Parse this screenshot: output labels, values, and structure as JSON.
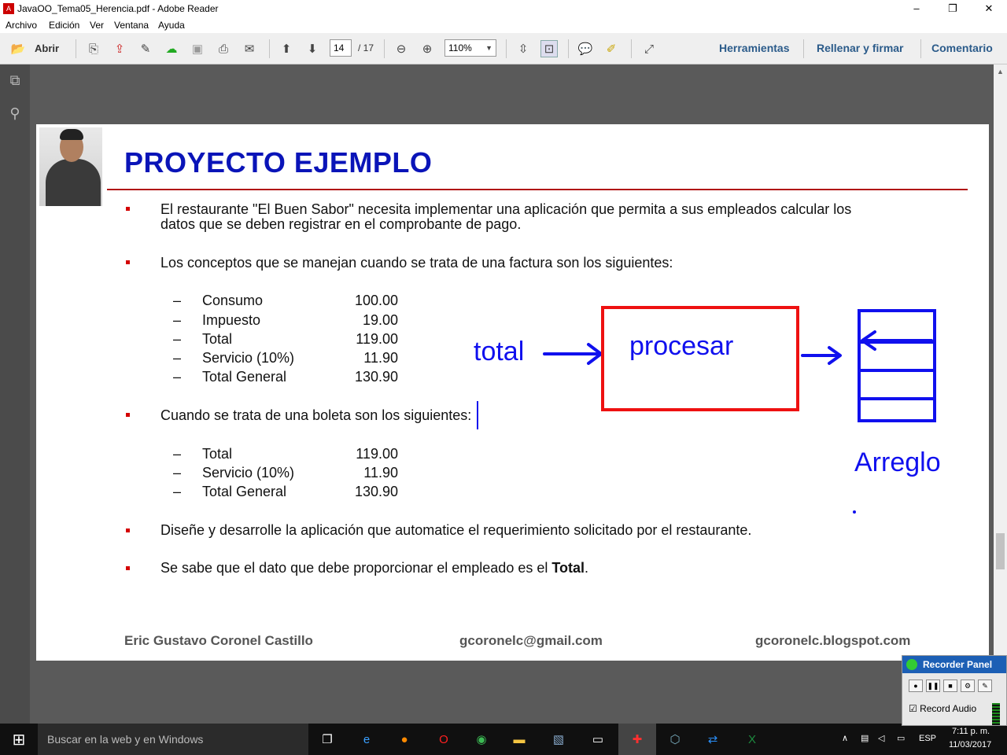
{
  "window": {
    "title": "JavaOO_Tema05_Herencia.pdf - Adobe Reader",
    "buttons": {
      "minimize": "–",
      "restore": "❐",
      "close": "✕"
    }
  },
  "menu": [
    "Archivo",
    "Edición",
    "Ver",
    "Ventana",
    "Ayuda"
  ],
  "toolbar": {
    "open_label": "Abrir",
    "page_current": "14",
    "page_total": "/ 17",
    "zoom": "110%",
    "right_links": [
      "Herramientas",
      "Rellenar y firmar",
      "Comentario"
    ]
  },
  "document": {
    "title": "PROYECTO EJEMPLO",
    "para1_line1": "El restaurante \"El Buen Sabor\" necesita implementar una aplicación que permita a sus empleados calcular los",
    "para1_line2": "datos que se deben registrar en el comprobante de pago.",
    "para2": "Los conceptos que se manejan cuando se trata de una factura son los siguientes:",
    "factura": [
      {
        "label": "Consumo",
        "value": "100.00"
      },
      {
        "label": "Impuesto",
        "value": "19.00"
      },
      {
        "label": "Total",
        "value": "119.00"
      },
      {
        "label": "Servicio (10%)",
        "value": "11.90"
      },
      {
        "label": "Total General",
        "value": "130.90"
      }
    ],
    "para3": "Cuando se trata de una boleta son los siguientes:",
    "boleta": [
      {
        "label": "Total",
        "value": "119.00"
      },
      {
        "label": "Servicio (10%)",
        "value": "11.90"
      },
      {
        "label": "Total General",
        "value": "130.90"
      }
    ],
    "para4": "Diseñe y desarrolle la aplicación que automatice el requerimiento solicitado por el restaurante.",
    "para5_prefix": "Se sabe que el dato que debe proporcionar el empleado es el ",
    "para5_bold": "Total",
    "para5_suffix": ".",
    "footer": {
      "author": "Eric Gustavo Coronel Castillo",
      "email": "gcoronelc@gmail.com",
      "blog": "gcoronelc.blogspot.com"
    },
    "annotations": {
      "input_label": "total",
      "process_label": "procesar",
      "array_label": "Arreglo",
      "ink_color": "#1010ee",
      "box_color": "#ee1111"
    }
  },
  "taskbar": {
    "search_placeholder": "Buscar en la web y en Windows",
    "language": "ESP",
    "time": "7:11 p. m.",
    "date": "11/03/2017"
  },
  "recorder": {
    "title": "Recorder Panel",
    "record_audio_label": "Record Audio"
  }
}
